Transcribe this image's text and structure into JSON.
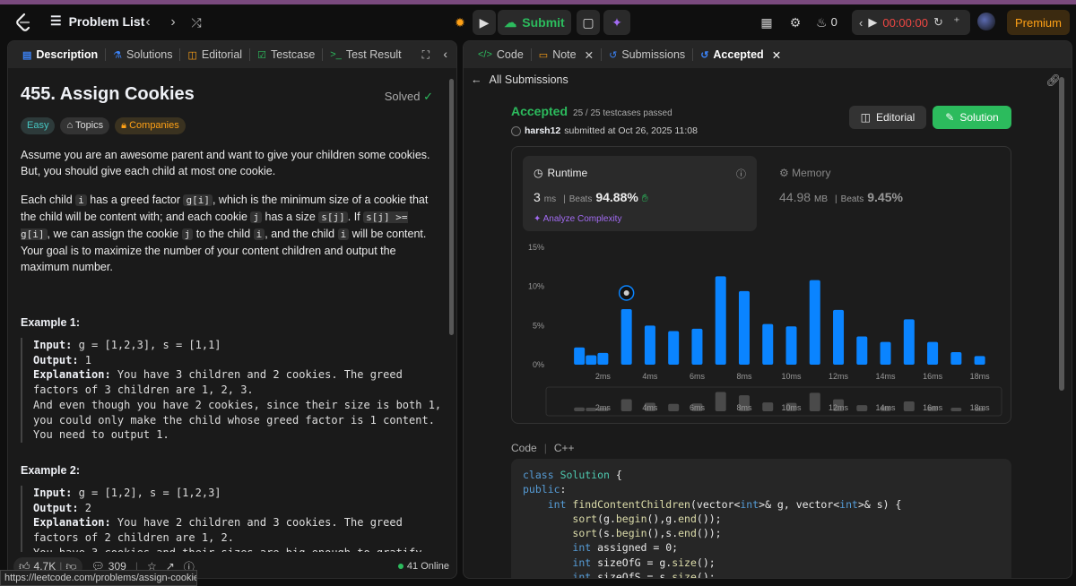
{
  "topbar": {
    "problem_list": "Problem List",
    "submit": "Submit",
    "streak": "0",
    "timer": "00:00:00",
    "premium": "Premium"
  },
  "left_tabs": [
    "Description",
    "Solutions",
    "Editorial",
    "Testcase",
    "Test Result"
  ],
  "problem": {
    "title": "455. Assign Cookies",
    "status": "Solved",
    "tags": [
      "Easy",
      "Topics",
      "Companies"
    ],
    "p1": "Assume you are an awesome parent and want to give your children some cookies. But, you should give each child at most one cookie.",
    "p2_a": "Each child ",
    "p2_i": "i",
    "p2_b": " has a greed factor ",
    "p2_gi": "g[i]",
    "p2_c": ", which is the minimum size of a cookie that the child will be content with; and each cookie ",
    "p2_j": "j",
    "p2_d": " has a size ",
    "p2_sj": "s[j]",
    "p2_e": ". If ",
    "p2_cond": "s[j] >= g[i]",
    "p2_f": ", we can assign the cookie ",
    "p2_j2": "j",
    "p2_g": " to the child ",
    "p2_i2": "i",
    "p2_h": ", and the child ",
    "p2_i3": "i",
    "p2_k": " will be content. Your goal is to maximize the number of your content children and output the maximum number.",
    "ex1_title": "Example 1:",
    "ex1_input": " g = [1,2,3], s = [1,1]",
    "ex1_output": " 1",
    "ex1_expl": " You have 3 children and 2 cookies. The greed\nfactors of 3 children are 1, 2, 3.\nAnd even though you have 2 cookies, since their size is both 1,\nyou could only make the child whose greed factor is 1 content.\nYou need to output 1.",
    "ex2_title": "Example 2:",
    "ex2_input": " g = [1,2], s = [1,2,3]",
    "ex2_output": " 2",
    "ex2_expl": " You have 2 children and 3 cookies. The greed\nfactors of 2 children are 1, 2.\nYou have 3 cookies and their sizes are big enough to gratify\nall of the children.",
    "label_input": "Input:",
    "label_output": "Output:",
    "label_expl": "Explanation:"
  },
  "footer": {
    "likes": "4.7K",
    "comments": "309",
    "online": "41 Online"
  },
  "right_tabs": [
    "Code",
    "Note",
    "Submissions",
    "Accepted"
  ],
  "submission": {
    "all_submissions": "All Submissions",
    "status": "Accepted",
    "passed": "25 / 25 testcases passed",
    "user": "harsh12",
    "submitted": "submitted at Oct 26, 2025 11:08",
    "editorial_btn": "Editorial",
    "solution_btn": "Solution",
    "runtime_label": "Runtime",
    "runtime_value": "3",
    "runtime_unit": "ms",
    "beats_label": "Beats",
    "runtime_beats": "94.88%",
    "analyze": "Analyze Complexity",
    "memory_label": "Memory",
    "memory_value": "44.98",
    "memory_unit": "MB",
    "memory_beats": "9.45%"
  },
  "chart_data": {
    "type": "bar",
    "y_ticks": [
      "15%",
      "10%",
      "5%",
      "0%"
    ],
    "x_ticks": [
      "2ms",
      "4ms",
      "6ms",
      "8ms",
      "10ms",
      "12ms",
      "14ms",
      "16ms",
      "18ms"
    ],
    "x": [
      1,
      1.5,
      2,
      3,
      4,
      5,
      6,
      7,
      8,
      9,
      10,
      11,
      12,
      13,
      14,
      15,
      16,
      17,
      18
    ],
    "values": [
      2.2,
      1.2,
      1.5,
      7.1,
      5.0,
      4.3,
      4.6,
      11.3,
      9.4,
      5.2,
      4.9,
      10.8,
      7.0,
      3.6,
      2.9,
      5.8,
      2.9,
      1.6,
      1.1
    ],
    "ylim": [
      0,
      15
    ],
    "highlight_x": 3,
    "color": "#0a84ff"
  },
  "code": {
    "header_label": "Code",
    "lang": "C++",
    "lines": [
      "class Solution {",
      "public:",
      "    int findContentChildren(vector<int>& g, vector<int>& s) {",
      "        sort(g.begin(),g.end());",
      "        sort(s.begin(),s.end());",
      "        int assigned = 0;",
      "        int sizeOfG = g.size();",
      "        int sizeOfS = s.size();"
    ]
  },
  "status_url": "https://leetcode.com/problems/assign-cookies/"
}
